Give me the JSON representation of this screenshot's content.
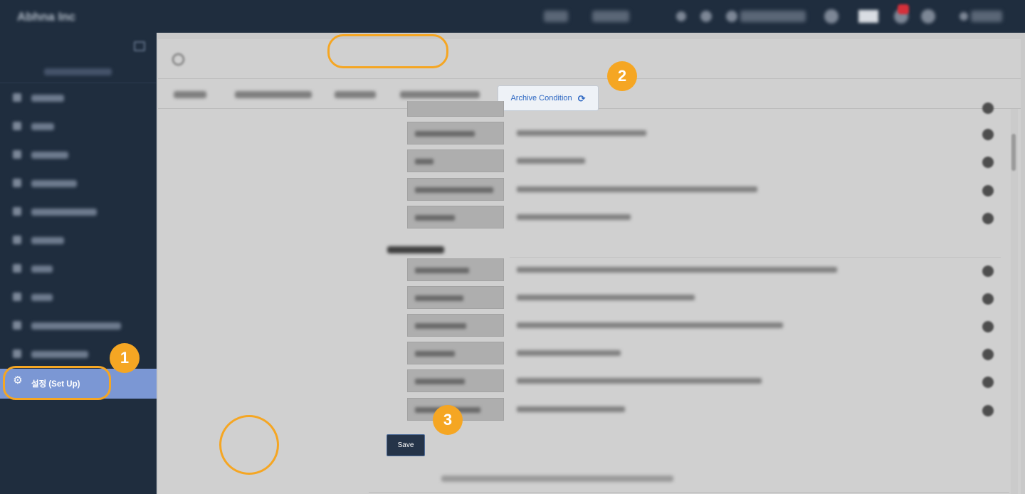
{
  "topbar": {
    "brand": "Abhna Inc"
  },
  "sidebar": {
    "active_item": {
      "label": "설정 (Set Up)",
      "icon": "gear-icon"
    }
  },
  "main": {
    "archive_button": {
      "label": "Archive Condition",
      "icon": "refresh-icon",
      "refresh_glyph": "⟳"
    },
    "save_button": {
      "label": "Save"
    }
  },
  "step_markers": [
    "1",
    "2",
    "3"
  ],
  "colors": {
    "marker": "#f5a623",
    "sidebar_bg": "#1f2d3e",
    "active_item_bg": "#7b97d4",
    "link_blue": "#2d67c2",
    "save_bg": "#253449"
  }
}
